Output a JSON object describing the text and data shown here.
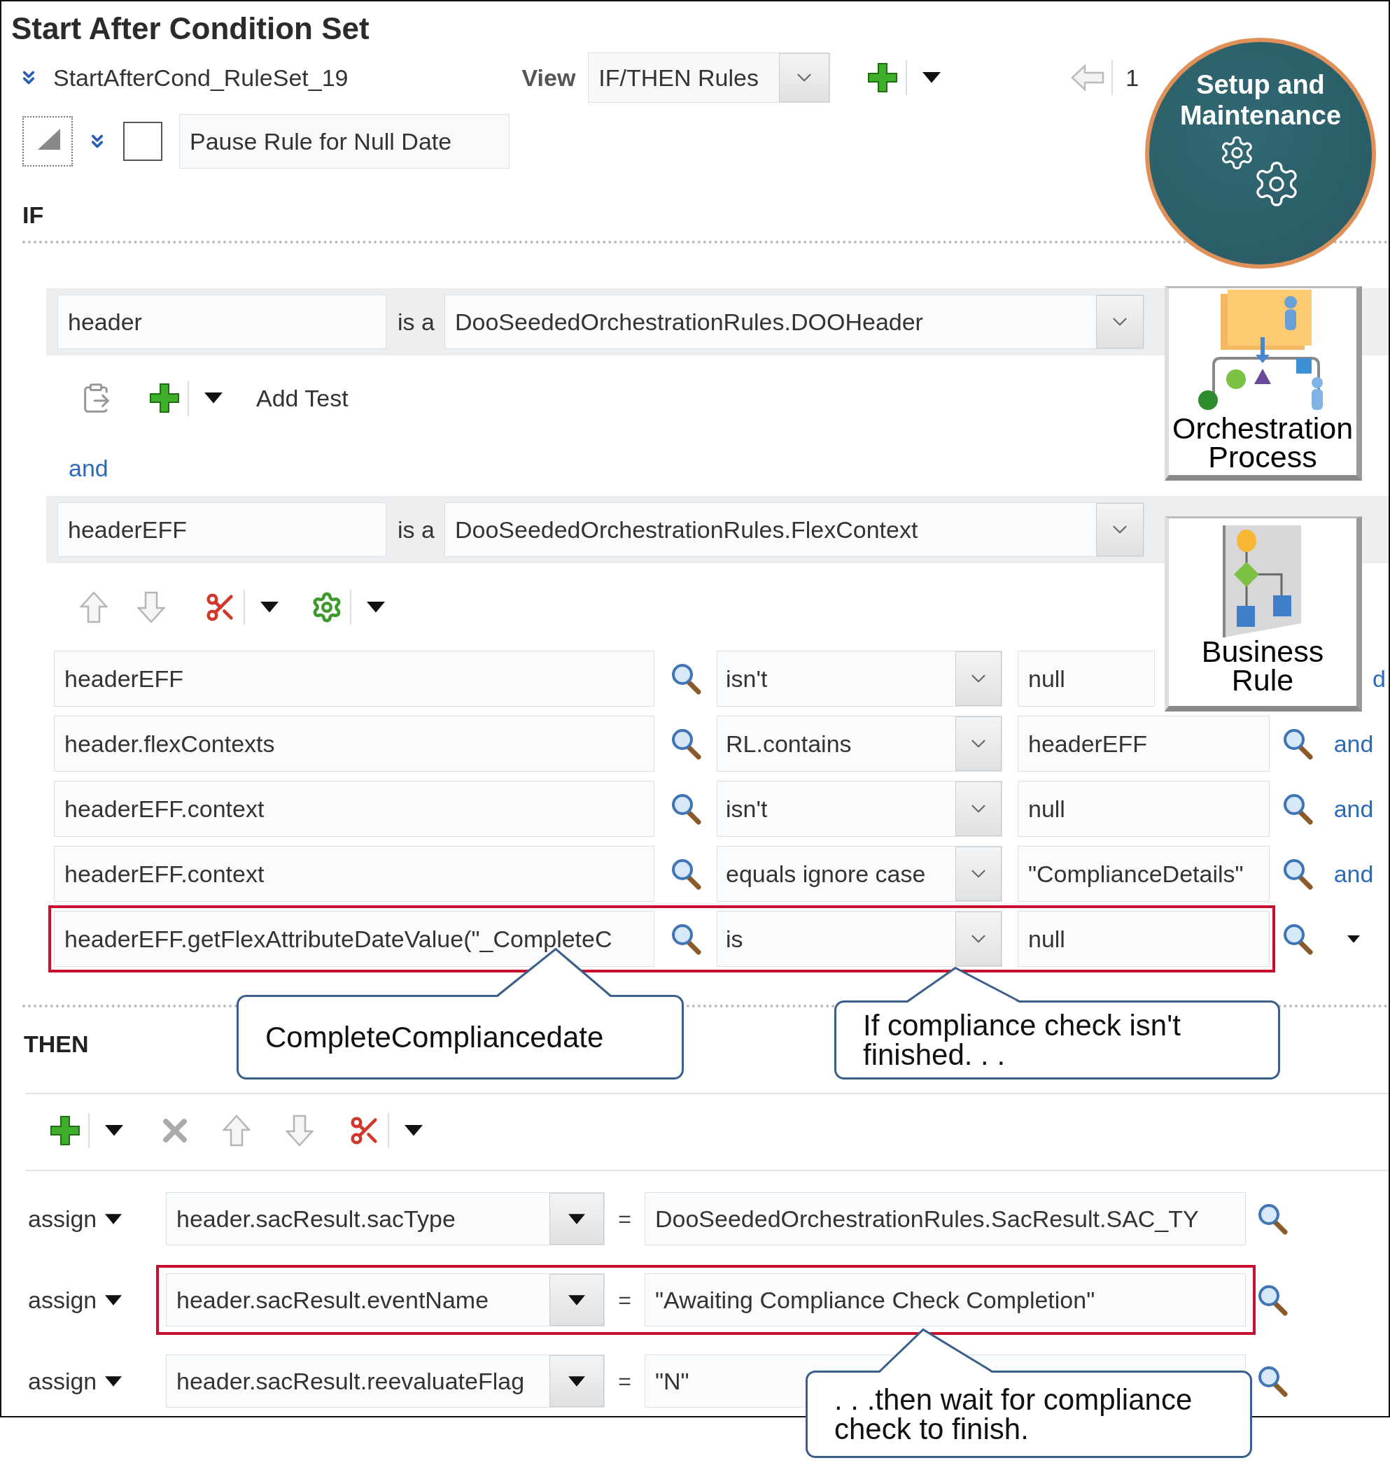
{
  "title": "Start After Condition Set",
  "ruleset": {
    "name": "StartAfterCond_RuleSet_19",
    "view_label": "View",
    "view_value": "IF/THEN Rules",
    "page": "1"
  },
  "rule": {
    "checked": false,
    "name": "Pause Rule for Null Date"
  },
  "if_label": "IF",
  "facts": [
    {
      "variable": "header",
      "is_a": "is a",
      "type": "DooSeededOrchestrationRules.DOOHeader"
    },
    {
      "variable": "headerEFF",
      "is_a": "is a",
      "type": "DooSeededOrchestrationRules.FlexContext"
    }
  ],
  "add_test": "Add Test",
  "and_link": "and",
  "tests": [
    {
      "kind": "partial",
      "left": "headerEFF",
      "operator": "isn't",
      "right": "null",
      "connector": "d",
      "highlighted": false
    },
    {
      "kind": "full",
      "left": "header.flexContexts",
      "operator": "RL.contains",
      "right": "headerEFF",
      "connector": "and",
      "highlighted": false
    },
    {
      "kind": "full",
      "left": "headerEFF.context",
      "operator": "isn't",
      "right": "null",
      "connector": "and",
      "highlighted": false
    },
    {
      "kind": "full",
      "left": "headerEFF.context",
      "operator": "equals ignore case",
      "right": "\"ComplianceDetails\"",
      "connector": "and",
      "highlighted": false
    },
    {
      "kind": "full",
      "left": "headerEFF.getFlexAttributeDateValue(\"_CompleteC",
      "operator": "is",
      "right": "null",
      "highlighted": true
    }
  ],
  "then_label": "THEN",
  "actions": [
    {
      "verb": "assign",
      "target": "header.sacResult.sacType",
      "equals": "=",
      "value": "DooSeededOrchestrationRules.SacResult.SAC_TY",
      "highlighted": false
    },
    {
      "verb": "assign",
      "target": "header.sacResult.eventName",
      "equals": "=",
      "value": "\"Awaiting Compliance Check Completion\"",
      "highlighted": true
    },
    {
      "verb": "assign",
      "target": "header.sacResult.reevaluateFlag",
      "equals": "=",
      "value": "\"N\"",
      "highlighted": false
    }
  ],
  "callouts": [
    {
      "text": "CompleteCompliancedate"
    },
    {
      "text": "If compliance check isn't\nfinished. . ."
    },
    {
      "text": ". . .then wait for compliance\ncheck to finish."
    }
  ],
  "badge": {
    "title": "Setup and\nMaintenance"
  },
  "tiles": [
    {
      "label": "Orchestration\nProcess",
      "kind": "orchestration"
    },
    {
      "label": "Business\nRule",
      "kind": "rule"
    }
  ]
}
